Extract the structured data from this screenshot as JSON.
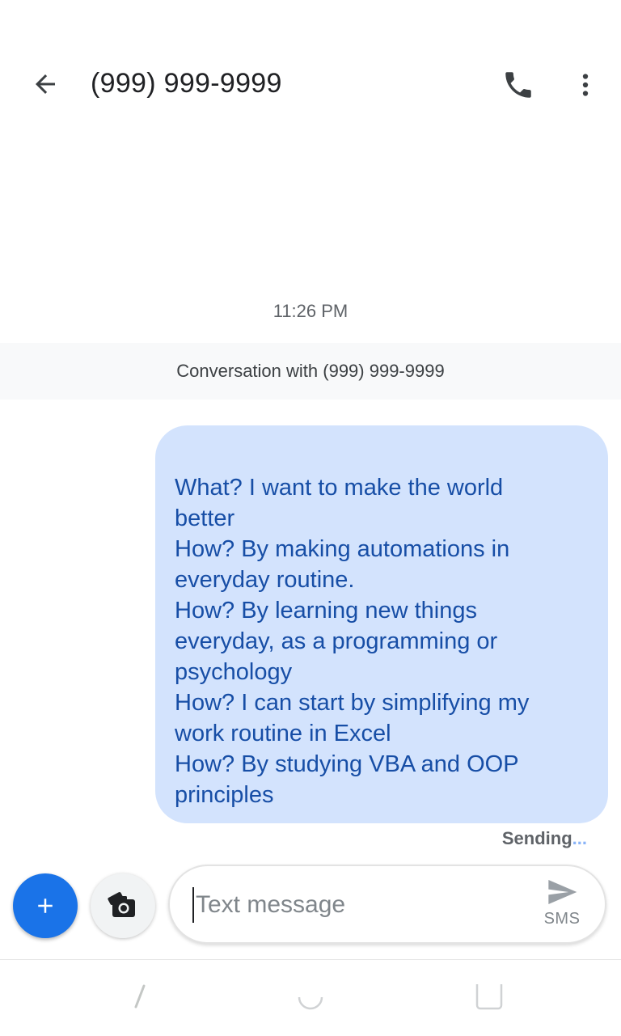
{
  "header": {
    "title": "(999) 999-9999",
    "back_icon": "arrow-back-icon",
    "call_icon": "phone-icon",
    "more_icon": "more-vert-icon"
  },
  "conversation": {
    "timestamp": "11:26 PM",
    "banner": "Conversation with (999) 999-9999",
    "message": {
      "lines": [
        "What? I want to make the world",
        "better",
        "How? By making automations in",
        "everyday routine.",
        "How? By learning new things",
        "everyday, as a programming or",
        "psychology",
        "How? I can start by simplifying my",
        "work routine in Excel",
        "How? By studying VBA and OOP",
        "principles"
      ],
      "status": "Sending",
      "status_dots": "..."
    }
  },
  "compose": {
    "placeholder": "Text message",
    "value": "",
    "send_label": "SMS",
    "attach_icon": "plus-icon",
    "camera_icon": "camera-icon",
    "send_icon": "send-icon"
  },
  "nav": {
    "back_icon": "nav-back-icon",
    "home_icon": "nav-home-icon",
    "recents_icon": "nav-recents-icon"
  },
  "colors": {
    "accent": "#1a73e8",
    "bubble": "#d3e3fd",
    "bubble_text": "#174ea6",
    "banner_bg": "#f8f9fa"
  }
}
